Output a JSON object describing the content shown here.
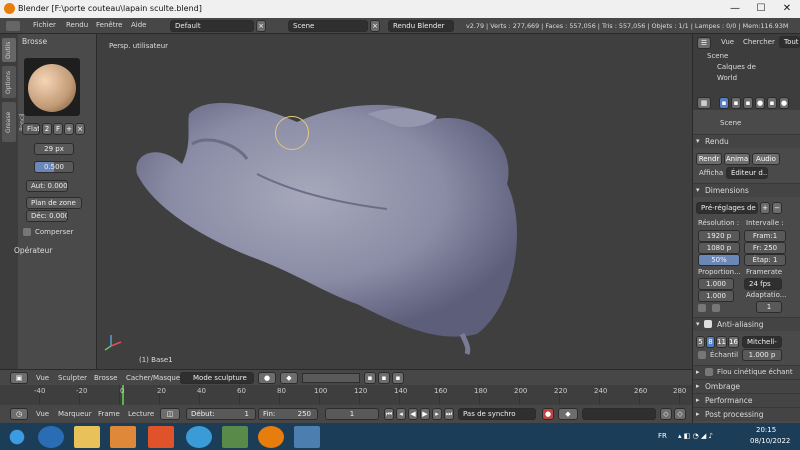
{
  "window": {
    "title": "Blender [F:\\porte couteau\\lapain sculte.blend]",
    "min": "—",
    "max": "☐",
    "close": "✕"
  },
  "menu": {
    "items": [
      "Fichier",
      "Rendu",
      "Fenêtre",
      "Aide"
    ],
    "layout": "Default",
    "scene": "Scene",
    "engine": "Rendu Blender",
    "stats": "v2.79 | Verts : 277,669 | Faces : 557,056 | Tris : 557,056 | Objets : 1/1 | Lampes : 0/0 | Mem:116.93M"
  },
  "left_panel": {
    "tabs": [
      "Outils",
      "Options",
      "Grease Pencil"
    ],
    "brush_header": "Brosse",
    "brush_name": "Flatt",
    "brush_users": "2",
    "brush_f": "F",
    "radius": "29 px",
    "strength": "0.500",
    "autosmooth": "Aut: 0.000",
    "plane": "Plan de zone",
    "offset": "Déc: 0.000",
    "compress_label": "Comperser",
    "operator_header": "Opérateur"
  },
  "viewport": {
    "label": "Persp. utilisateur",
    "object": "(1) Base1"
  },
  "vp_header": {
    "items": [
      "Vue",
      "Sculpter",
      "Brosse",
      "Cacher/Masquer"
    ],
    "mode": "Mode sculpture"
  },
  "timeline": {
    "ticks": [
      "-40",
      "-20",
      "0",
      "20",
      "40",
      "60",
      "80",
      "100",
      "120",
      "140",
      "160",
      "180",
      "200",
      "220",
      "240",
      "260",
      "280"
    ],
    "menu": [
      "Vue",
      "Marqueur",
      "Frame",
      "Lecture"
    ],
    "start": "Début:",
    "start_val": "1",
    "end": "Fin:",
    "end_val": "250",
    "current": "1",
    "sync": "Pas de synchro"
  },
  "right_panel": {
    "outliner_tabs": [
      "Vue",
      "Chercher",
      "Tout"
    ],
    "outliner_items": [
      "Scene",
      "Calques de",
      "World"
    ],
    "scene_label": "Scene",
    "render_section": "Rendu",
    "render_btns": [
      "Rendr",
      "Anima",
      "Audio"
    ],
    "display_label": "Afficha",
    "display_value": "Éditeur d...",
    "dimensions_section": "Dimensions",
    "presets": "Pré-réglages de",
    "resolution_label": "Résolution :",
    "interval_label": "Intervalle :",
    "res_x": "1920 p",
    "res_y": "1080 p",
    "res_pct": "50%",
    "frame_start": "Fram:1",
    "frame_end": "Fr: 250",
    "frame_step": "Étap: 1",
    "aspect_label": "Proportion...",
    "framerate_label": "Framerate",
    "aspect_x": "1.000",
    "aspect_y": "1.000",
    "fps": "24 fps",
    "adapt_label": "Adaptatio...",
    "adapt_val": "1",
    "aa_section": "Anti-aliasing",
    "aa_samples": [
      "5",
      "8",
      "11",
      "16"
    ],
    "aa_filter": "Mitchell-",
    "aa_sample_label": "Échantil",
    "aa_size": "1.000 p",
    "motion_blur": "Flou cinétique échant",
    "shading": "Ombrage",
    "performance": "Performance",
    "post": "Post processing"
  },
  "taskbar": {
    "lang": "FR",
    "time": "20:15",
    "date": "08/10/2022"
  },
  "colors": {
    "accent": "#5680c2",
    "mesh": "#8d8fa8",
    "taskbar": "#1c3d57"
  }
}
